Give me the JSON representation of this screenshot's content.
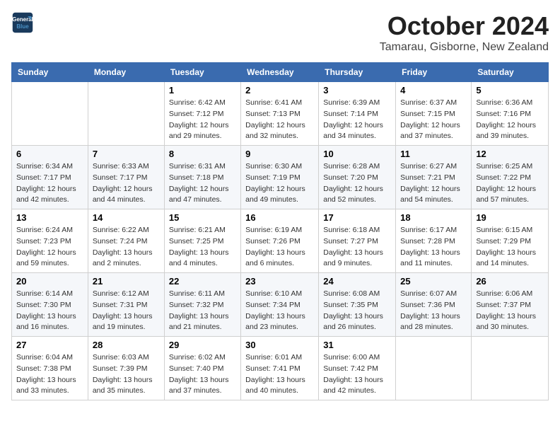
{
  "header": {
    "logo_line1": "General",
    "logo_line2": "Blue",
    "month": "October 2024",
    "location": "Tamarau, Gisborne, New Zealand"
  },
  "weekdays": [
    "Sunday",
    "Monday",
    "Tuesday",
    "Wednesday",
    "Thursday",
    "Friday",
    "Saturday"
  ],
  "weeks": [
    [
      {
        "day": "",
        "sunrise": "",
        "sunset": "",
        "daylight": ""
      },
      {
        "day": "",
        "sunrise": "",
        "sunset": "",
        "daylight": ""
      },
      {
        "day": "1",
        "sunrise": "Sunrise: 6:42 AM",
        "sunset": "Sunset: 7:12 PM",
        "daylight": "Daylight: 12 hours and 29 minutes."
      },
      {
        "day": "2",
        "sunrise": "Sunrise: 6:41 AM",
        "sunset": "Sunset: 7:13 PM",
        "daylight": "Daylight: 12 hours and 32 minutes."
      },
      {
        "day": "3",
        "sunrise": "Sunrise: 6:39 AM",
        "sunset": "Sunset: 7:14 PM",
        "daylight": "Daylight: 12 hours and 34 minutes."
      },
      {
        "day": "4",
        "sunrise": "Sunrise: 6:37 AM",
        "sunset": "Sunset: 7:15 PM",
        "daylight": "Daylight: 12 hours and 37 minutes."
      },
      {
        "day": "5",
        "sunrise": "Sunrise: 6:36 AM",
        "sunset": "Sunset: 7:16 PM",
        "daylight": "Daylight: 12 hours and 39 minutes."
      }
    ],
    [
      {
        "day": "6",
        "sunrise": "Sunrise: 6:34 AM",
        "sunset": "Sunset: 7:17 PM",
        "daylight": "Daylight: 12 hours and 42 minutes."
      },
      {
        "day": "7",
        "sunrise": "Sunrise: 6:33 AM",
        "sunset": "Sunset: 7:17 PM",
        "daylight": "Daylight: 12 hours and 44 minutes."
      },
      {
        "day": "8",
        "sunrise": "Sunrise: 6:31 AM",
        "sunset": "Sunset: 7:18 PM",
        "daylight": "Daylight: 12 hours and 47 minutes."
      },
      {
        "day": "9",
        "sunrise": "Sunrise: 6:30 AM",
        "sunset": "Sunset: 7:19 PM",
        "daylight": "Daylight: 12 hours and 49 minutes."
      },
      {
        "day": "10",
        "sunrise": "Sunrise: 6:28 AM",
        "sunset": "Sunset: 7:20 PM",
        "daylight": "Daylight: 12 hours and 52 minutes."
      },
      {
        "day": "11",
        "sunrise": "Sunrise: 6:27 AM",
        "sunset": "Sunset: 7:21 PM",
        "daylight": "Daylight: 12 hours and 54 minutes."
      },
      {
        "day": "12",
        "sunrise": "Sunrise: 6:25 AM",
        "sunset": "Sunset: 7:22 PM",
        "daylight": "Daylight: 12 hours and 57 minutes."
      }
    ],
    [
      {
        "day": "13",
        "sunrise": "Sunrise: 6:24 AM",
        "sunset": "Sunset: 7:23 PM",
        "daylight": "Daylight: 12 hours and 59 minutes."
      },
      {
        "day": "14",
        "sunrise": "Sunrise: 6:22 AM",
        "sunset": "Sunset: 7:24 PM",
        "daylight": "Daylight: 13 hours and 2 minutes."
      },
      {
        "day": "15",
        "sunrise": "Sunrise: 6:21 AM",
        "sunset": "Sunset: 7:25 PM",
        "daylight": "Daylight: 13 hours and 4 minutes."
      },
      {
        "day": "16",
        "sunrise": "Sunrise: 6:19 AM",
        "sunset": "Sunset: 7:26 PM",
        "daylight": "Daylight: 13 hours and 6 minutes."
      },
      {
        "day": "17",
        "sunrise": "Sunrise: 6:18 AM",
        "sunset": "Sunset: 7:27 PM",
        "daylight": "Daylight: 13 hours and 9 minutes."
      },
      {
        "day": "18",
        "sunrise": "Sunrise: 6:17 AM",
        "sunset": "Sunset: 7:28 PM",
        "daylight": "Daylight: 13 hours and 11 minutes."
      },
      {
        "day": "19",
        "sunrise": "Sunrise: 6:15 AM",
        "sunset": "Sunset: 7:29 PM",
        "daylight": "Daylight: 13 hours and 14 minutes."
      }
    ],
    [
      {
        "day": "20",
        "sunrise": "Sunrise: 6:14 AM",
        "sunset": "Sunset: 7:30 PM",
        "daylight": "Daylight: 13 hours and 16 minutes."
      },
      {
        "day": "21",
        "sunrise": "Sunrise: 6:12 AM",
        "sunset": "Sunset: 7:31 PM",
        "daylight": "Daylight: 13 hours and 19 minutes."
      },
      {
        "day": "22",
        "sunrise": "Sunrise: 6:11 AM",
        "sunset": "Sunset: 7:32 PM",
        "daylight": "Daylight: 13 hours and 21 minutes."
      },
      {
        "day": "23",
        "sunrise": "Sunrise: 6:10 AM",
        "sunset": "Sunset: 7:34 PM",
        "daylight": "Daylight: 13 hours and 23 minutes."
      },
      {
        "day": "24",
        "sunrise": "Sunrise: 6:08 AM",
        "sunset": "Sunset: 7:35 PM",
        "daylight": "Daylight: 13 hours and 26 minutes."
      },
      {
        "day": "25",
        "sunrise": "Sunrise: 6:07 AM",
        "sunset": "Sunset: 7:36 PM",
        "daylight": "Daylight: 13 hours and 28 minutes."
      },
      {
        "day": "26",
        "sunrise": "Sunrise: 6:06 AM",
        "sunset": "Sunset: 7:37 PM",
        "daylight": "Daylight: 13 hours and 30 minutes."
      }
    ],
    [
      {
        "day": "27",
        "sunrise": "Sunrise: 6:04 AM",
        "sunset": "Sunset: 7:38 PM",
        "daylight": "Daylight: 13 hours and 33 minutes."
      },
      {
        "day": "28",
        "sunrise": "Sunrise: 6:03 AM",
        "sunset": "Sunset: 7:39 PM",
        "daylight": "Daylight: 13 hours and 35 minutes."
      },
      {
        "day": "29",
        "sunrise": "Sunrise: 6:02 AM",
        "sunset": "Sunset: 7:40 PM",
        "daylight": "Daylight: 13 hours and 37 minutes."
      },
      {
        "day": "30",
        "sunrise": "Sunrise: 6:01 AM",
        "sunset": "Sunset: 7:41 PM",
        "daylight": "Daylight: 13 hours and 40 minutes."
      },
      {
        "day": "31",
        "sunrise": "Sunrise: 6:00 AM",
        "sunset": "Sunset: 7:42 PM",
        "daylight": "Daylight: 13 hours and 42 minutes."
      },
      {
        "day": "",
        "sunrise": "",
        "sunset": "",
        "daylight": ""
      },
      {
        "day": "",
        "sunrise": "",
        "sunset": "",
        "daylight": ""
      }
    ]
  ]
}
